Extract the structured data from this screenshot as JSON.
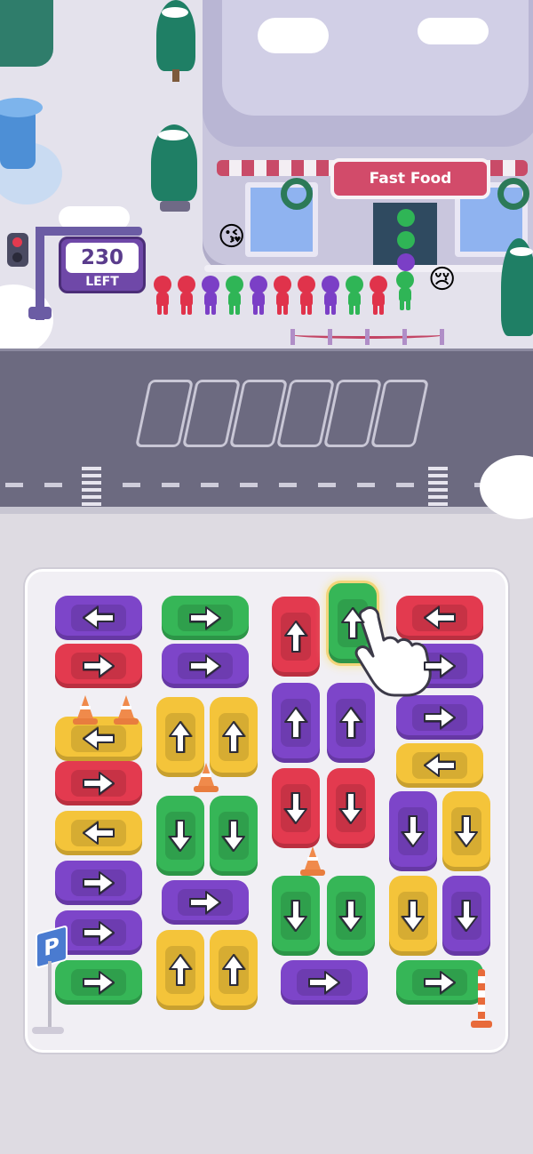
{
  "hud": {
    "remaining_count": "230",
    "remaining_label": "LEFT"
  },
  "store": {
    "sign_text": "Fast Food"
  },
  "queue": {
    "colors": [
      "#e0334b",
      "#e0334b",
      "#7b3fc6",
      "#2fb556",
      "#7b3fc6",
      "#e0334b",
      "#e0334b",
      "#7b3fc6",
      "#2fb556",
      "#e0334b",
      "#2fb556"
    ],
    "happy_emoji": "😘",
    "sad_emoji": "😢"
  },
  "parking_slots": {
    "count": 6,
    "filled": 0
  },
  "palette": {
    "red": "#e33a4f",
    "green": "#36b657",
    "purple": "#7d45c9",
    "yellow": "#f4c43a"
  },
  "cars": [
    {
      "color": "purple",
      "dir": "left"
    },
    {
      "color": "red",
      "dir": "right"
    },
    {
      "color": "yellow",
      "dir": "left"
    },
    {
      "color": "red",
      "dir": "right"
    },
    {
      "color": "yellow",
      "dir": "left"
    },
    {
      "color": "purple",
      "dir": "right"
    },
    {
      "color": "purple",
      "dir": "right"
    },
    {
      "color": "green",
      "dir": "right"
    },
    {
      "color": "green",
      "dir": "right"
    },
    {
      "color": "purple",
      "dir": "right"
    },
    {
      "color": "yellow",
      "dir": "up"
    },
    {
      "color": "yellow",
      "dir": "up"
    },
    {
      "color": "green",
      "dir": "down"
    },
    {
      "color": "green",
      "dir": "down"
    },
    {
      "color": "purple",
      "dir": "right"
    },
    {
      "color": "yellow",
      "dir": "up"
    },
    {
      "color": "yellow",
      "dir": "up"
    },
    {
      "color": "red",
      "dir": "up"
    },
    {
      "color": "green",
      "dir": "up"
    },
    {
      "color": "purple",
      "dir": "up"
    },
    {
      "color": "purple",
      "dir": "up"
    },
    {
      "color": "red",
      "dir": "down"
    },
    {
      "color": "red",
      "dir": "down"
    },
    {
      "color": "green",
      "dir": "down"
    },
    {
      "color": "green",
      "dir": "down"
    },
    {
      "color": "purple",
      "dir": "right"
    },
    {
      "color": "red",
      "dir": "left"
    },
    {
      "color": "purple",
      "dir": "right"
    },
    {
      "color": "purple",
      "dir": "right"
    },
    {
      "color": "yellow",
      "dir": "left"
    },
    {
      "color": "purple",
      "dir": "down"
    },
    {
      "color": "yellow",
      "dir": "down"
    },
    {
      "color": "yellow",
      "dir": "down"
    },
    {
      "color": "purple",
      "dir": "down"
    },
    {
      "color": "green",
      "dir": "right"
    }
  ],
  "signs": {
    "parking": "P"
  }
}
